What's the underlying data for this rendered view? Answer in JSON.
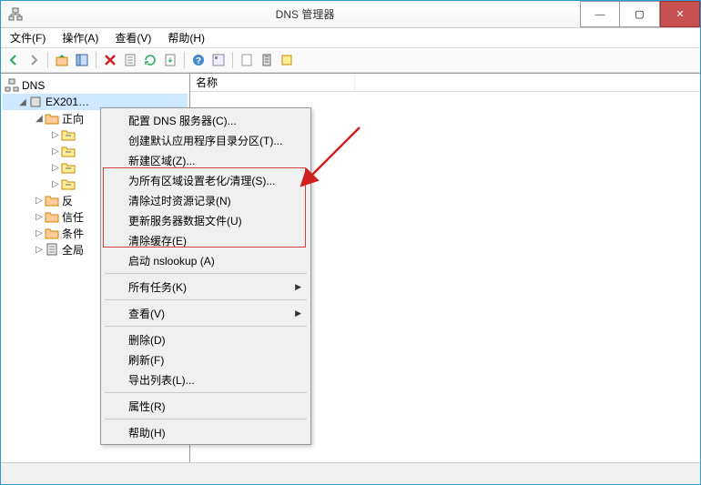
{
  "window": {
    "title": "DNS 管理器"
  },
  "menubar": {
    "file": "文件(F)",
    "action": "操作(A)",
    "view": "查看(V)",
    "help": "帮助(H)"
  },
  "tree": {
    "root": "DNS",
    "server": "EX201…",
    "zone_fwd": "正向",
    "sub1": "",
    "sub2": "",
    "sub3": "",
    "sub4": "",
    "zone_rev": "反",
    "trust": "信任",
    "cond": "条件",
    "global": "全局"
  },
  "right": {
    "col_name": "名称"
  },
  "ctx": {
    "configure": "配置 DNS 服务器(C)...",
    "create_default": "创建默认应用程序目录分区(T)...",
    "new_zone": "新建区域(Z)...",
    "set_aging": "为所有区域设置老化/清理(S)...",
    "clear_stale": "清除过时资源记录(N)",
    "update_server": "更新服务器数据文件(U)",
    "clear_cache": "清除缓存(E)",
    "start_nslookup": "启动 nslookup (A)",
    "all_tasks": "所有任务(K)",
    "view": "查看(V)",
    "delete": "删除(D)",
    "refresh": "刷新(F)",
    "export": "导出列表(L)...",
    "properties": "属性(R)",
    "help": "帮助(H)"
  }
}
